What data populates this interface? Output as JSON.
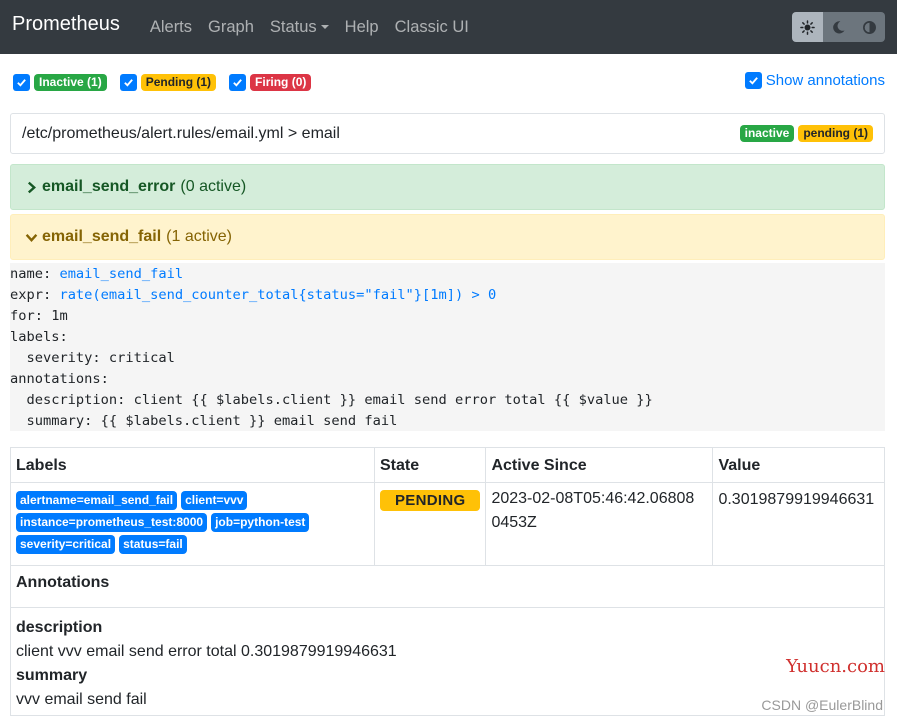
{
  "navbar": {
    "brand": "Prometheus",
    "links": [
      "Alerts",
      "Graph",
      "Status",
      "Help",
      "Classic UI"
    ],
    "theme_buttons": [
      "sun-icon",
      "moon-icon",
      "contrast-icon"
    ]
  },
  "filters": {
    "inactive": "Inactive (1)",
    "pending": "Pending (1)",
    "firing": "Firing (0)",
    "show_annotations": "Show annotations"
  },
  "rule_file": {
    "path": "/etc/prometheus/alert.rules/email.yml > email",
    "badge_inactive": "inactive",
    "badge_pending": "pending (1)"
  },
  "alerts": [
    {
      "name": "email_send_error",
      "count": "(0 active)"
    },
    {
      "name": "email_send_fail",
      "count": "(1 active)"
    }
  ],
  "rule": {
    "name_key": "name: ",
    "name_val": "email_send_fail",
    "expr_key": "expr: ",
    "expr_val": "rate(email_send_counter_total{status=\"fail\"}[1m]) > 0",
    "for_line": "for: 1m",
    "labels_line": "labels:",
    "severity_line": "  severity: critical",
    "annotations_line": "annotations:",
    "description_line": "  description: client {{ $labels.client }} email send error total {{ $value }}",
    "summary_line": "  summary: {{ $labels.client }} email send fail"
  },
  "table": {
    "headers": [
      "Labels",
      "State",
      "Active Since",
      "Value"
    ],
    "labels": [
      "alertname=email_send_fail",
      "client=vvv",
      "instance=prometheus_test:8000",
      "job=python-test",
      "severity=critical",
      "status=fail"
    ],
    "state": "PENDING",
    "active_since": "2023-02-08T05:46:42.068080453Z",
    "value": "0.3019879919946631",
    "annotations_title": "Annotations",
    "desc_label": "description",
    "desc_value": "client vvv email send error total 0.3019879919946631",
    "summary_label": "summary",
    "summary_value": "vvv email send fail"
  },
  "watermarks": {
    "site": "Yuucn.com",
    "author": "CSDN @EulerBlind"
  }
}
